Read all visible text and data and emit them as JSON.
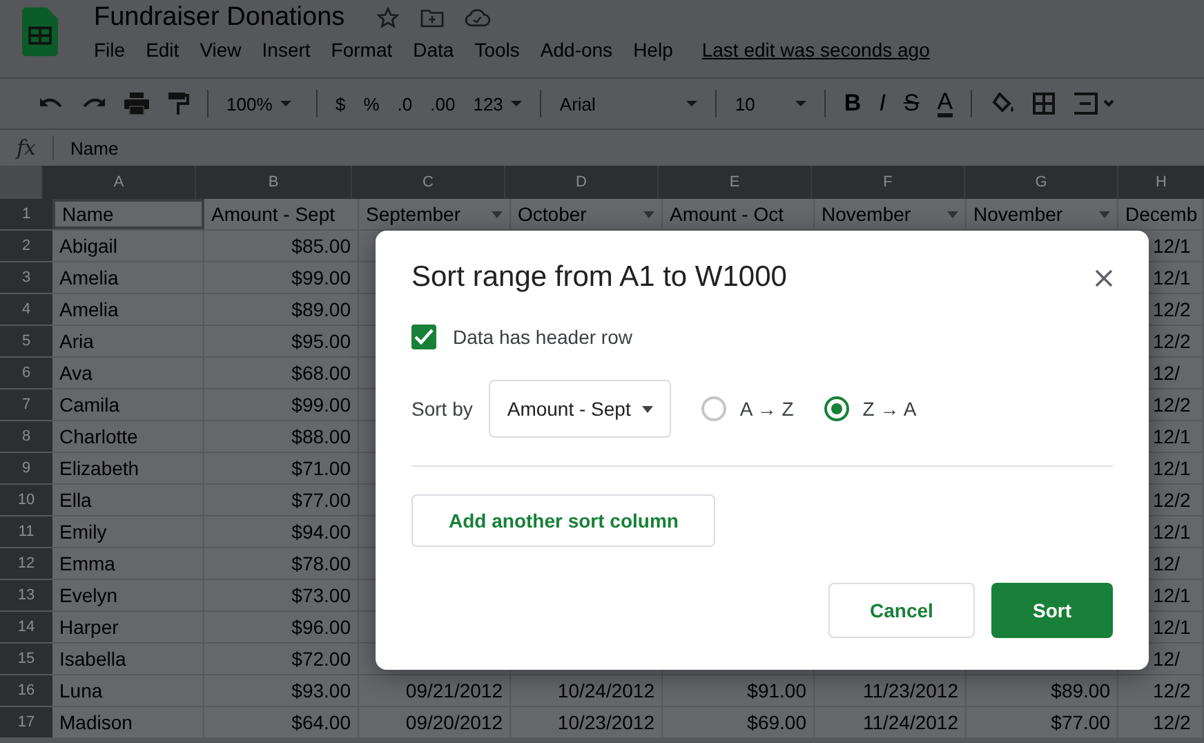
{
  "title_bar": {
    "title": "Fundraiser Donations",
    "menu": [
      "File",
      "Edit",
      "View",
      "Insert",
      "Format",
      "Data",
      "Tools",
      "Add-ons",
      "Help"
    ],
    "last_edit": "Last edit was seconds ago"
  },
  "toolbar": {
    "zoom": "100%",
    "currency": "$",
    "percent": "%",
    "decrease_decimals": ".0",
    "increase_decimals": ".00",
    "number_format": "123",
    "font": "Arial",
    "font_size": "10",
    "bold": "B",
    "italic": "I",
    "strikethrough": "S",
    "text_color": "A"
  },
  "formula_bar": {
    "function_label": "fx",
    "value": "Name"
  },
  "sheet": {
    "column_letters": [
      "A",
      "B",
      "C",
      "D",
      "E",
      "F",
      "G",
      "H"
    ],
    "header_row": {
      "number": "1",
      "cells": [
        {
          "text": "Name",
          "filter": false,
          "selected": true
        },
        {
          "text": "Amount - Sept",
          "filter": false,
          "selected": false
        },
        {
          "text": "September",
          "filter": true,
          "selected": false
        },
        {
          "text": "October",
          "filter": true,
          "selected": false
        },
        {
          "text": "Amount - Oct",
          "filter": false,
          "selected": false
        },
        {
          "text": "November",
          "filter": true,
          "selected": false
        },
        {
          "text": "November",
          "filter": true,
          "selected": false
        },
        {
          "text": "Decemb",
          "filter": false,
          "selected": false
        }
      ]
    },
    "rows": [
      {
        "number": "2",
        "a": "Abigail",
        "b": "$85.00",
        "h": "12/1"
      },
      {
        "number": "3",
        "a": "Amelia",
        "b": "$99.00",
        "h": "12/1"
      },
      {
        "number": "4",
        "a": "Amelia",
        "b": "$89.00",
        "h": "12/2"
      },
      {
        "number": "5",
        "a": "Aria",
        "b": "$95.00",
        "h": "12/2"
      },
      {
        "number": "6",
        "a": "Ava",
        "b": "$68.00",
        "h": "12/"
      },
      {
        "number": "7",
        "a": "Camila",
        "b": "$99.00",
        "h": "12/2"
      },
      {
        "number": "8",
        "a": "Charlotte",
        "b": "$88.00",
        "h": "12/1"
      },
      {
        "number": "9",
        "a": "Elizabeth",
        "b": "$71.00",
        "h": "12/1"
      },
      {
        "number": "10",
        "a": "Ella",
        "b": "$77.00",
        "h": "12/2"
      },
      {
        "number": "11",
        "a": "Emily",
        "b": "$94.00",
        "h": "12/1"
      },
      {
        "number": "12",
        "a": "Emma",
        "b": "$78.00",
        "h": "12/"
      },
      {
        "number": "13",
        "a": "Evelyn",
        "b": "$73.00",
        "h": "12/1"
      },
      {
        "number": "14",
        "a": "Harper",
        "b": "$96.00",
        "h": "12/1"
      },
      {
        "number": "15",
        "a": "Isabella",
        "b": "$72.00",
        "h": "12/"
      },
      {
        "number": "16",
        "a": "Luna",
        "b": "$93.00",
        "c": "09/21/2012",
        "d": "10/24/2012",
        "e": "$91.00",
        "f": "11/23/2012",
        "g": "$89.00",
        "h": "12/2"
      },
      {
        "number": "17",
        "a": "Madison",
        "b": "$64.00",
        "c": "09/20/2012",
        "d": "10/23/2012",
        "e": "$69.00",
        "f": "11/24/2012",
        "g": "$77.00",
        "h": "12/2"
      }
    ]
  },
  "dialog": {
    "title": "Sort range from A1 to W1000",
    "header_row": {
      "label": "Data has header row",
      "checked": true
    },
    "sort_by_label": "Sort by",
    "sort_column": "Amount - Sept",
    "orders": [
      {
        "label": "A → Z",
        "selected": false
      },
      {
        "label": "Z → A",
        "selected": true
      }
    ],
    "add_column": "Add another sort column",
    "buttons": [
      {
        "label": "Cancel",
        "kind": "secondary"
      },
      {
        "label": "Sort",
        "kind": "primary"
      }
    ]
  }
}
